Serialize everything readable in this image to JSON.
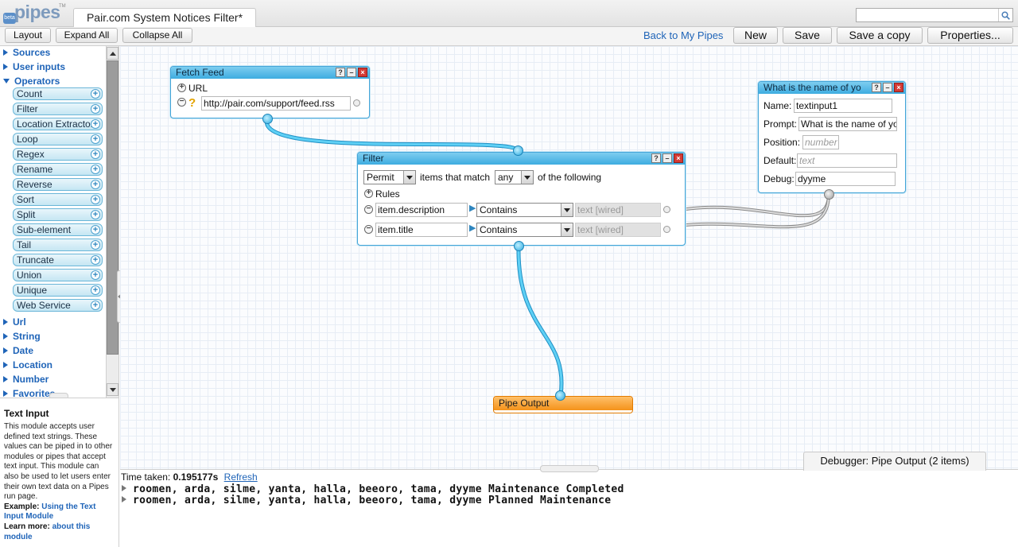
{
  "app": {
    "logo_text": "pipes",
    "logo_badge": "beta",
    "logo_tm": "TM",
    "tab_title": "Pair.com System Notices Filter*",
    "search": {
      "value": "",
      "placeholder": ""
    }
  },
  "toolbar": {
    "layout": "Layout",
    "expand_all": "Expand All",
    "collapse_all": "Collapse All",
    "back_link": "Back to My Pipes",
    "new": "New",
    "save": "Save",
    "save_copy": "Save a copy",
    "properties": "Properties..."
  },
  "sidebar": {
    "sources": "Sources",
    "user_inputs": "User inputs",
    "operators": "Operators",
    "operator_items": [
      "Count",
      "Filter",
      "Location Extractor",
      "Loop",
      "Regex",
      "Rename",
      "Reverse",
      "Sort",
      "Split",
      "Sub-element",
      "Tail",
      "Truncate",
      "Union",
      "Unique",
      "Web Service"
    ],
    "url": "Url",
    "string": "String",
    "date": "Date",
    "location": "Location",
    "number": "Number",
    "favorites": "Favorites"
  },
  "help": {
    "title": "Text Input",
    "body": "This module accepts user defined text strings. These values can be piped in to other modules or pipes that accept text input. This module can also be used to let users enter their own text data on a Pipes run page.",
    "example_label": "Example:",
    "example_link": "Using the Text Input Module",
    "learn_label": "Learn more:",
    "learn_link": "about this module"
  },
  "fetch_feed": {
    "title": "Fetch Feed",
    "url_label": "URL",
    "url_value": "http://pair.com/support/feed.rss"
  },
  "filter": {
    "title": "Filter",
    "mode": "Permit",
    "items_that_match": "items that match",
    "match": "any",
    "of_the_following": "of the following",
    "rules_label": "Rules",
    "rules": [
      {
        "field": "item.description",
        "op": "Contains",
        "value": "text [wired]"
      },
      {
        "field": "item.title",
        "op": "Contains",
        "value": "text [wired]"
      }
    ]
  },
  "text_input": {
    "title": "What is the name of yo",
    "name_label": "Name:",
    "name_value": "textinput1",
    "prompt_label": "Prompt:",
    "prompt_value": "What is the name of yo",
    "position_label": "Position:",
    "position_placeholder": "number",
    "default_label": "Default:",
    "default_placeholder": "text",
    "debug_label": "Debug:",
    "debug_value": "dyyme"
  },
  "pipe_output": {
    "title": "Pipe Output"
  },
  "debugger": {
    "tab": "Debugger: Pipe Output (2 items)",
    "time_label": "Time taken:",
    "time_value": "0.195177s",
    "refresh": "Refresh",
    "rows": [
      "roomen, arda, silme, yanta, halla, beeoro, tama, dyyme Maintenance Completed",
      "roomen, arda, silme, yanta, halla, beeoro, tama, dyyme Planned Maintenance"
    ]
  },
  "colors": {
    "module_header": "#3eace0",
    "wire": "#29b2e8",
    "output_header": "#f4921a",
    "link": "#1f64b8"
  }
}
